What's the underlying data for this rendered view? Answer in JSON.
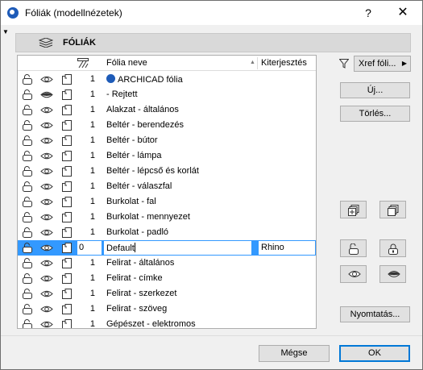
{
  "window": {
    "title": "Fóliák (modellnézetek)",
    "help": "?",
    "close": "✕"
  },
  "section": {
    "title": "FÓLIÁK"
  },
  "list": {
    "header": {
      "name": "Fólia neve",
      "extension": "Kiterjesztés"
    },
    "rows": [
      {
        "lock": "unlocked",
        "visible": true,
        "num": "1",
        "name": "ARCHICAD fólia",
        "ext": "",
        "archicad": true
      },
      {
        "lock": "unlocked",
        "visible": false,
        "num": "1",
        "name": "- Rejtett",
        "ext": ""
      },
      {
        "lock": "unlocked",
        "visible": true,
        "num": "1",
        "name": "Alakzat - általános",
        "ext": ""
      },
      {
        "lock": "unlocked",
        "visible": true,
        "num": "1",
        "name": "Beltér - berendezés",
        "ext": ""
      },
      {
        "lock": "unlocked",
        "visible": true,
        "num": "1",
        "name": "Beltér - bútor",
        "ext": ""
      },
      {
        "lock": "unlocked",
        "visible": true,
        "num": "1",
        "name": "Beltér - lámpa",
        "ext": ""
      },
      {
        "lock": "unlocked",
        "visible": true,
        "num": "1",
        "name": "Beltér - lépcső és korlát",
        "ext": ""
      },
      {
        "lock": "unlocked",
        "visible": true,
        "num": "1",
        "name": "Beltér - válaszfal",
        "ext": ""
      },
      {
        "lock": "unlocked",
        "visible": true,
        "num": "1",
        "name": "Burkolat - fal",
        "ext": ""
      },
      {
        "lock": "unlocked",
        "visible": true,
        "num": "1",
        "name": "Burkolat - mennyezet",
        "ext": ""
      },
      {
        "lock": "unlocked",
        "visible": true,
        "num": "1",
        "name": "Burkolat - padló",
        "ext": ""
      },
      {
        "lock": "unlocked",
        "visible": true,
        "num": "0",
        "name": "Default",
        "ext": "Rhino",
        "selected": true
      },
      {
        "lock": "unlocked",
        "visible": true,
        "num": "1",
        "name": "Felirat - általános",
        "ext": ""
      },
      {
        "lock": "unlocked",
        "visible": true,
        "num": "1",
        "name": "Felirat - címke",
        "ext": ""
      },
      {
        "lock": "unlocked",
        "visible": true,
        "num": "1",
        "name": "Felirat - szerkezet",
        "ext": ""
      },
      {
        "lock": "unlocked",
        "visible": true,
        "num": "1",
        "name": "Felirat - szöveg",
        "ext": ""
      },
      {
        "lock": "unlocked",
        "visible": true,
        "num": "1",
        "name": "Gépészet - elektromos",
        "ext": ""
      }
    ]
  },
  "controls": {
    "xref": "Xref fóli...",
    "new": "Új...",
    "delete": "Törlés...",
    "print": "Nyomtatás...",
    "cancel": "Mégse",
    "ok": "OK"
  },
  "icons": {
    "app": "archicad-icon",
    "section": "layers-icon",
    "header": "hatch-icon",
    "filter": "filter-icon",
    "duplicate_left": "stack-duplicate-icon",
    "duplicate_right": "stack-icon",
    "unlock": "unlock-icon",
    "lock": "lock-icon",
    "show": "eye-icon",
    "hide": "eye-closed-icon"
  },
  "colors": {
    "selection": "#3399ff",
    "ok_border": "#0078d7",
    "archicad_blue": "#1e5bb8"
  }
}
